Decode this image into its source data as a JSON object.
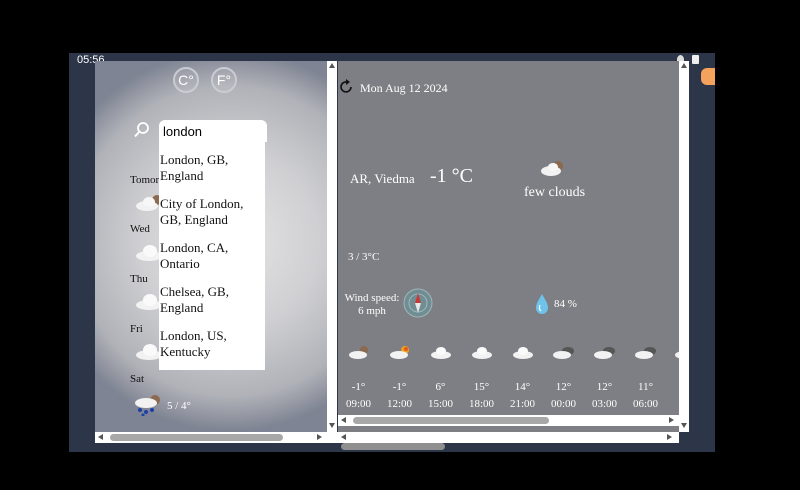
{
  "status": {
    "time": "05:56"
  },
  "units": {
    "celsius": "C°",
    "fahrenheit": "F°"
  },
  "search": {
    "value": "london"
  },
  "suggestions": [
    {
      "label": "London, GB, England"
    },
    {
      "label": "City of London, GB, England"
    },
    {
      "label": "London, CA, Ontario"
    },
    {
      "label": "Chelsea, GB, England"
    },
    {
      "label": "London, US, Kentucky"
    }
  ],
  "daily": [
    {
      "day": "Tomor",
      "icon": "few-clouds-icon"
    },
    {
      "day": "Wed",
      "icon": "cloud-icon"
    },
    {
      "day": "Thu",
      "icon": "cloud-icon"
    },
    {
      "day": "Fri",
      "icon": "cloud-icon"
    },
    {
      "day": "Sat",
      "icon": "rain-icon",
      "temp": "5 / 4°"
    }
  ],
  "current": {
    "date": "Mon Aug 12 2024",
    "location": "AR, Viedma",
    "temp": "-1 °C",
    "condition": "few clouds",
    "minmax": "3 / 3°C",
    "wind_label": "Wind speed:",
    "wind_value": "6 mph",
    "humidity": "84 %"
  },
  "hourly": [
    {
      "temp": "-1°",
      "time": "09:00",
      "icon": "few-clouds-icon"
    },
    {
      "temp": "-1°",
      "time": "12:00",
      "icon": "sun-cloud-icon"
    },
    {
      "temp": "6°",
      "time": "15:00",
      "icon": "cloud-icon"
    },
    {
      "temp": "15°",
      "time": "18:00",
      "icon": "cloud-icon"
    },
    {
      "temp": "14°",
      "time": "21:00",
      "icon": "cloud-icon"
    },
    {
      "temp": "12°",
      "time": "00:00",
      "icon": "dark-cloud-icon"
    },
    {
      "temp": "12°",
      "time": "03:00",
      "icon": "dark-cloud-icon"
    },
    {
      "temp": "11°",
      "time": "06:00",
      "icon": "dark-cloud-icon"
    }
  ],
  "colors": {
    "page_bg": "#2d3548",
    "panel": "#7e7f84",
    "accent": "#f5a25d"
  }
}
